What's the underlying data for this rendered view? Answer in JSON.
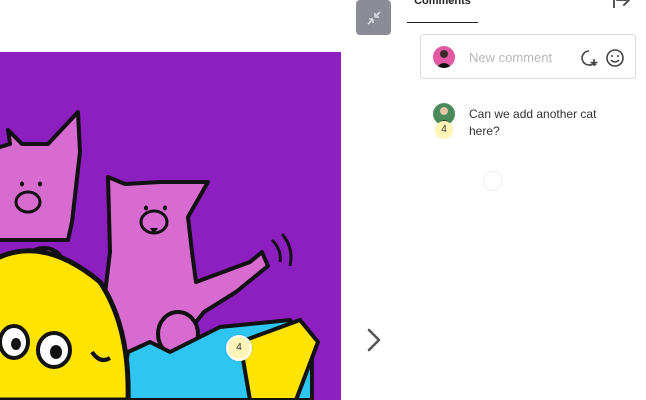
{
  "panel": {
    "tab_label": "Comments",
    "new_comment_placeholder": "New comment"
  },
  "artwork": {
    "pin_number": "4",
    "background_color": "#8d1fc1"
  },
  "comments": [
    {
      "text": "Can we add another cat here?",
      "badge": "4"
    }
  ],
  "icons": {
    "collapse": "collapse-arrows-icon",
    "exit": "panel-exit-icon",
    "add_annotation": "add-annotation-icon",
    "emoji": "smiley-icon",
    "next": "chevron-right-icon"
  }
}
